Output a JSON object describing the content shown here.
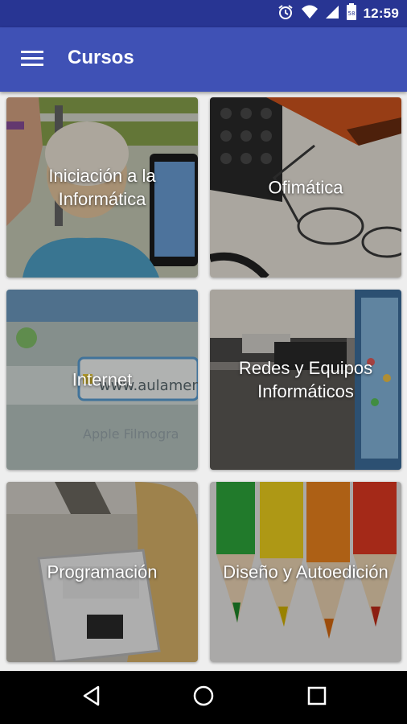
{
  "status_bar": {
    "time": "12:59",
    "icons": [
      "alarm-icon",
      "wifi-icon",
      "cellular-signal-icon",
      "battery-icon"
    ],
    "color": "#283593"
  },
  "app_bar": {
    "title": "Cursos",
    "menu_icon": "hamburger-menu-icon",
    "color": "#3f51b5"
  },
  "courses": [
    {
      "label_line1": "Iniciación a la",
      "label_line2": "Informática"
    },
    {
      "label_line1": "Ofimática",
      "label_line2": ""
    },
    {
      "label_line1": "Internet",
      "label_line2": ""
    },
    {
      "label_line1": "Redes y Equipos",
      "label_line2": "Informáticos"
    },
    {
      "label_line1": "Programación",
      "label_line2": ""
    },
    {
      "label_line1": "Diseño y Autoedición",
      "label_line2": ""
    }
  ],
  "nav_bar": {
    "icons": [
      "back-icon",
      "home-icon",
      "recents-icon"
    ]
  }
}
